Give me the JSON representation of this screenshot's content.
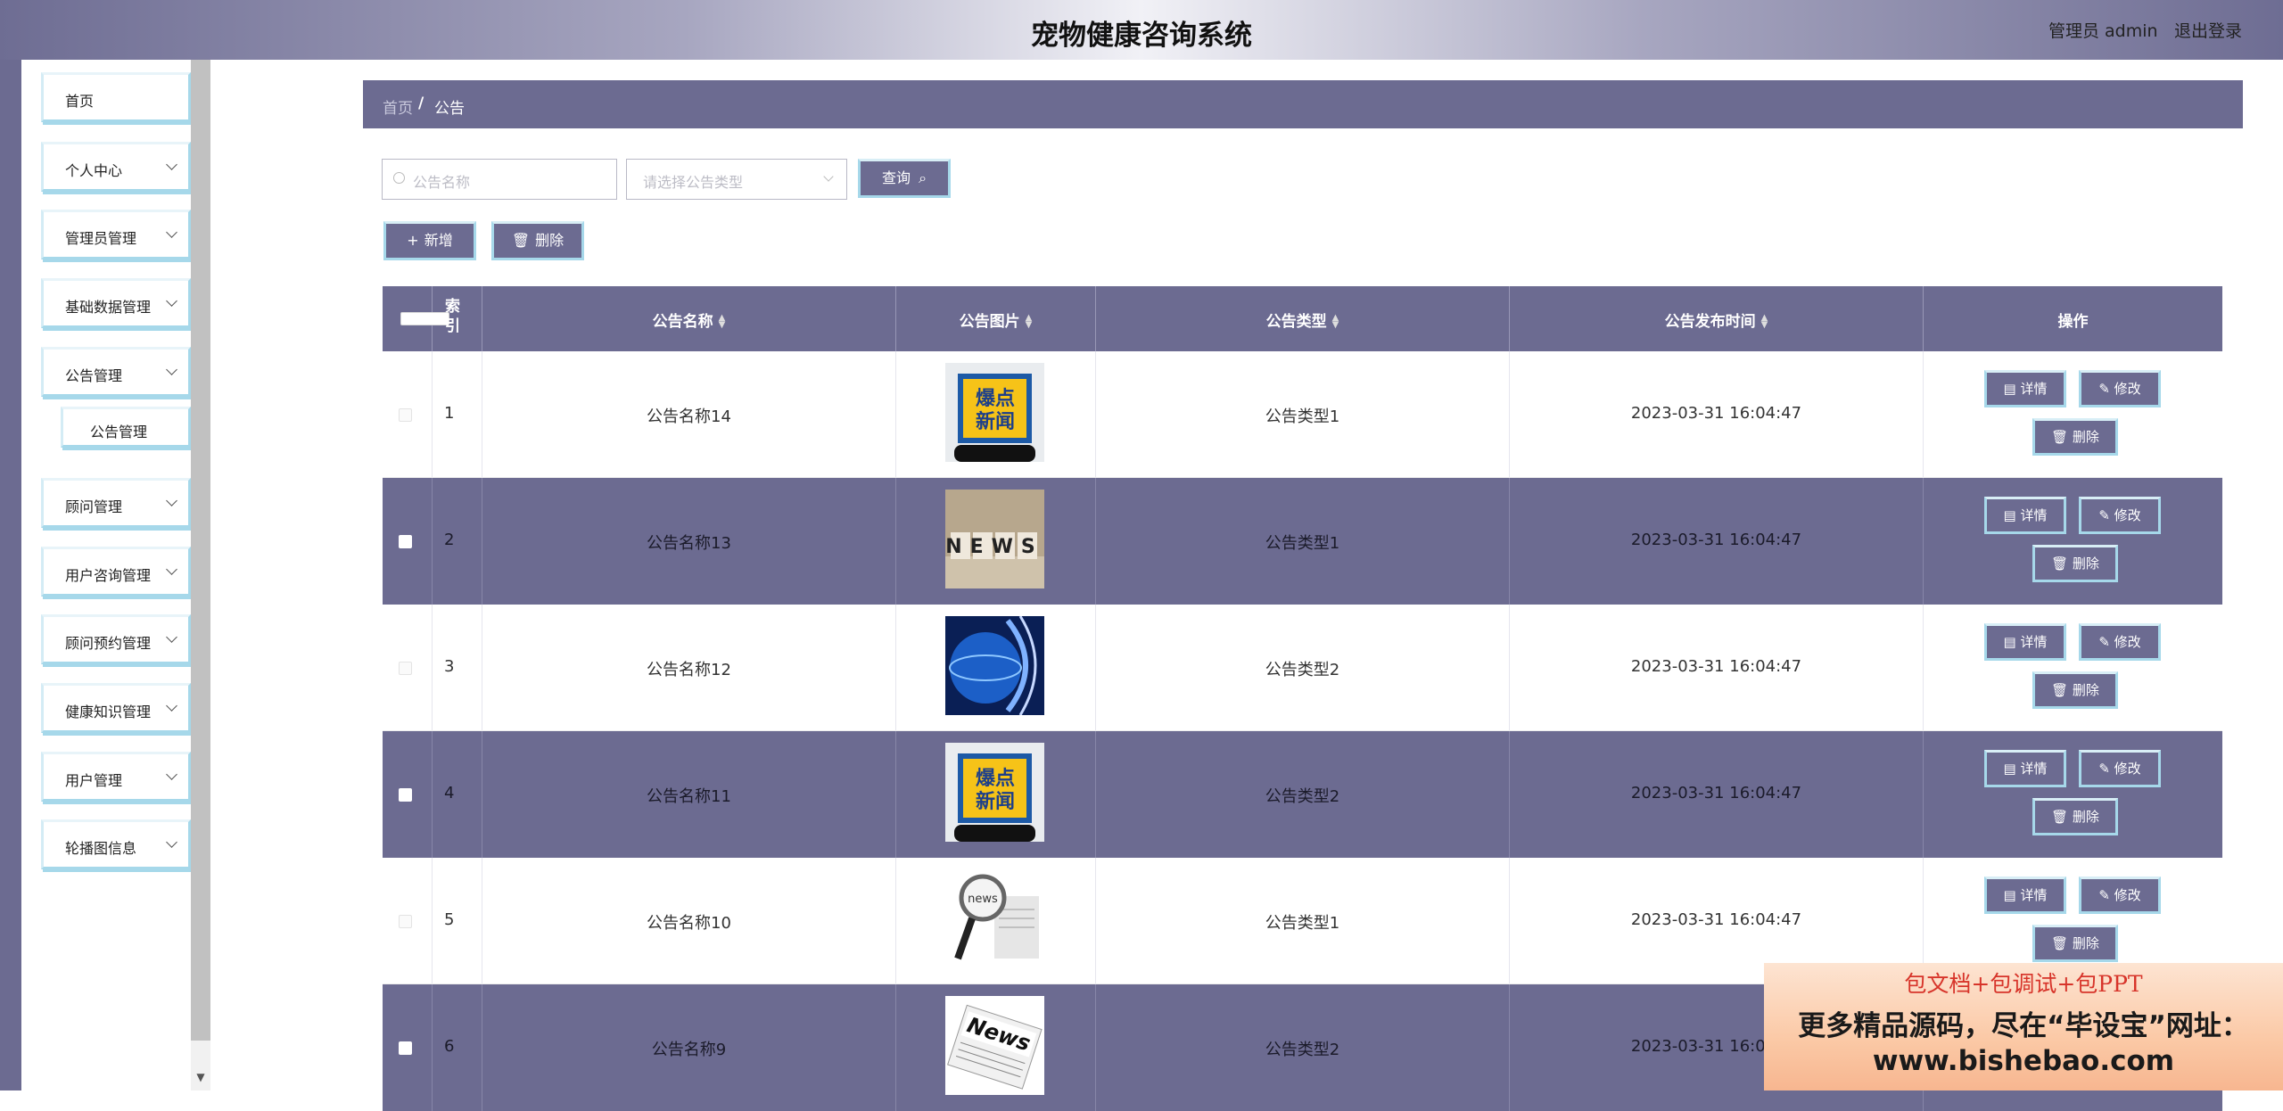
{
  "header": {
    "title": "宠物健康咨询系统",
    "user": "管理员 admin",
    "logout": "退出登录"
  },
  "sidebar": {
    "items": [
      {
        "label": "首页",
        "has_children": false
      },
      {
        "label": "个人中心",
        "has_children": true
      },
      {
        "label": "管理员管理",
        "has_children": true
      },
      {
        "label": "基础数据管理",
        "has_children": true
      },
      {
        "label": "公告管理",
        "has_children": true
      },
      {
        "label": "公告管理",
        "is_submenu": true
      },
      {
        "label": "顾问管理",
        "has_children": true
      },
      {
        "label": "用户咨询管理",
        "has_children": true
      },
      {
        "label": "顾问预约管理",
        "has_children": true
      },
      {
        "label": "健康知识管理",
        "has_children": true
      },
      {
        "label": "用户管理",
        "has_children": true
      },
      {
        "label": "轮播图信息",
        "has_children": true
      }
    ]
  },
  "breadcrumb": {
    "home": "首页",
    "separator": "/",
    "current": "公告"
  },
  "search": {
    "name_placeholder": "公告名称",
    "type_placeholder": "请选择公告类型",
    "query_label": "查询"
  },
  "toolbar": {
    "add_label": "新增",
    "delete_label": "删除"
  },
  "table": {
    "headers": {
      "index": "索引",
      "name": "公告名称",
      "image": "公告图片",
      "type": "公告类型",
      "time": "公告发布时间",
      "actions": "操作"
    },
    "rows": [
      {
        "index": "1",
        "name": "公告名称14",
        "image": "breaking-news-badge",
        "type": "公告类型1",
        "time": "2023-03-31 16:04:47"
      },
      {
        "index": "2",
        "name": "公告名称13",
        "image": "news-letter-blocks",
        "type": "公告类型1",
        "time": "2023-03-31 16:04:47"
      },
      {
        "index": "3",
        "name": "公告名称12",
        "image": "blue-globe",
        "type": "公告类型2",
        "time": "2023-03-31 16:04:47"
      },
      {
        "index": "4",
        "name": "公告名称11",
        "image": "breaking-news-badge",
        "type": "公告类型2",
        "time": "2023-03-31 16:04:47"
      },
      {
        "index": "5",
        "name": "公告名称10",
        "image": "magnifier-news",
        "type": "公告类型1",
        "time": "2023-03-31 16:04:47"
      },
      {
        "index": "6",
        "name": "公告名称9",
        "image": "newspaper-news",
        "type": "公告类型2",
        "time": "2023-03-31 16:04:47"
      }
    ],
    "actions": {
      "view": "详情",
      "edit": "修改",
      "delete": "删除"
    }
  },
  "badge_text": "爆点新闻",
  "news_word": "NEWS",
  "watermark": {
    "line1": "包文档+包调试+包PPT",
    "line2": "更多精品源码，尽在“毕设宝”网址：",
    "line3": "www.bishebao.com"
  }
}
